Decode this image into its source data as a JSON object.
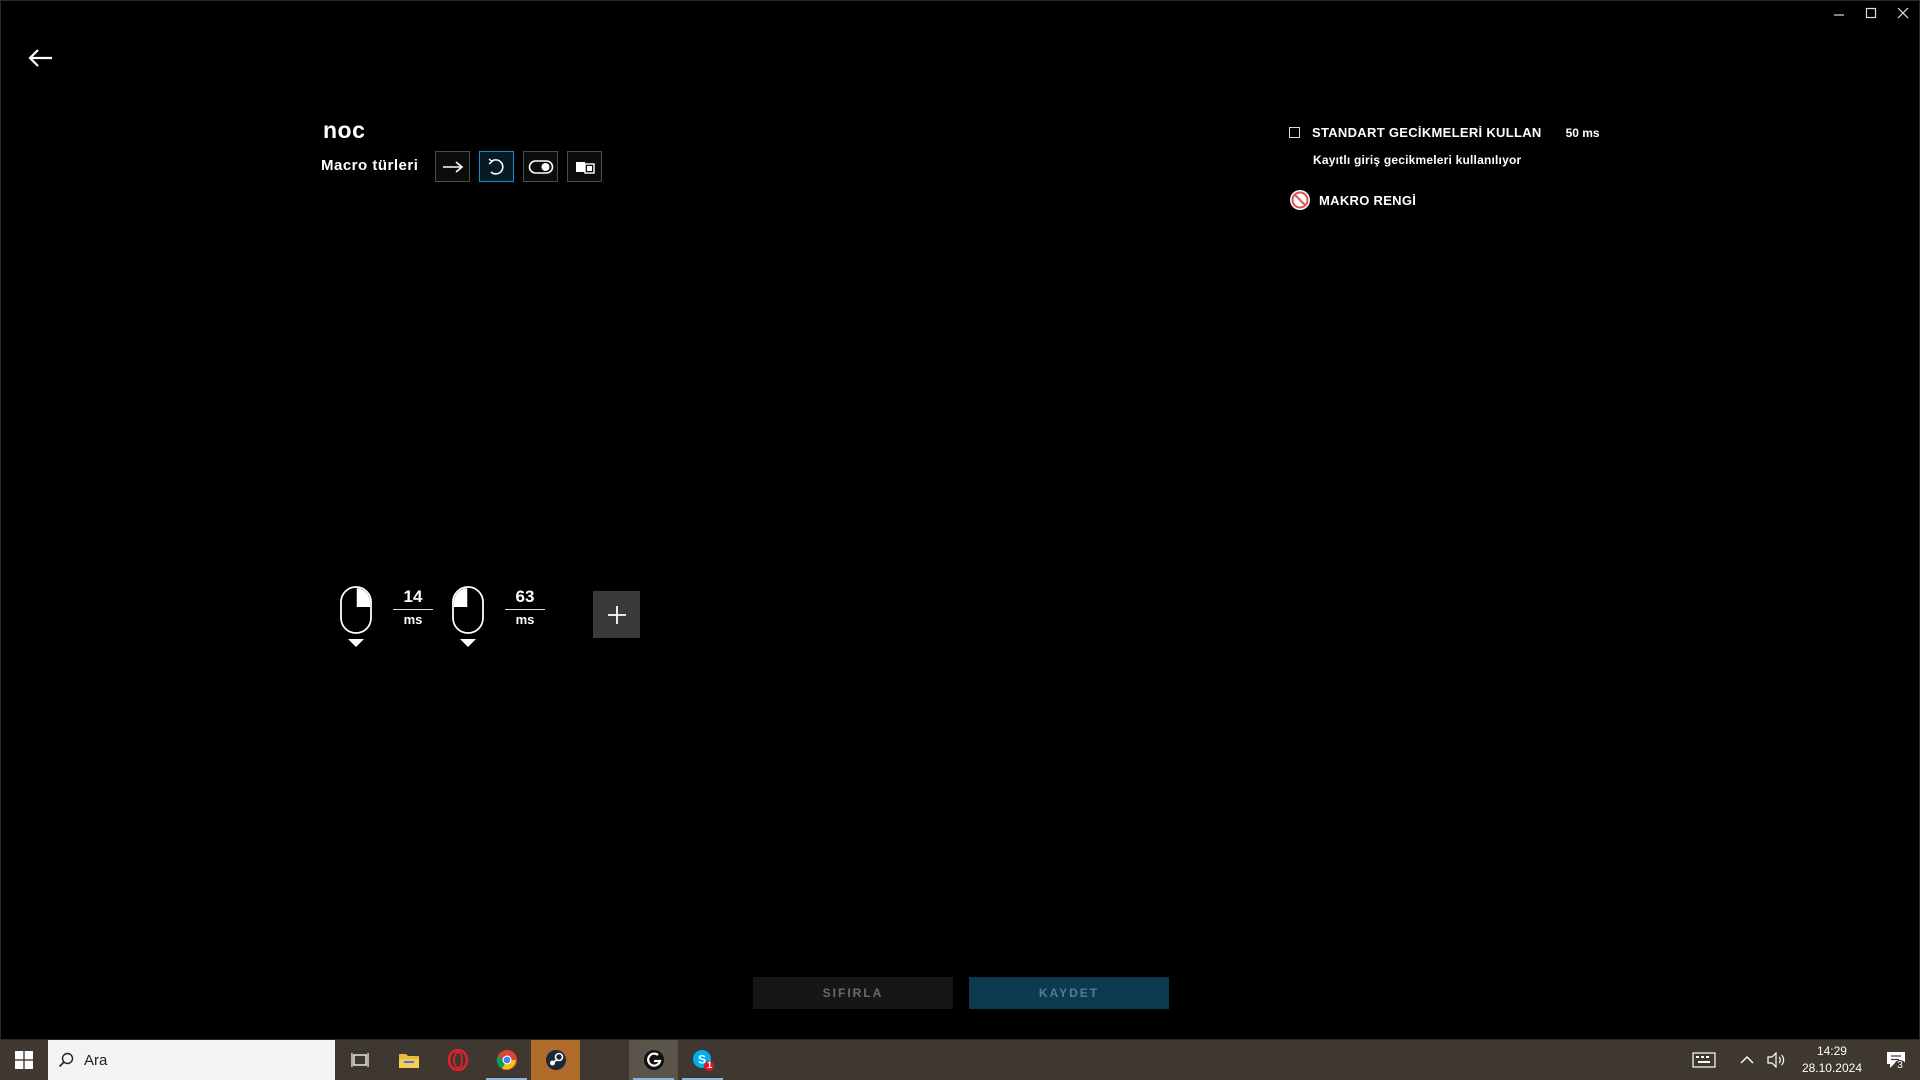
{
  "window": {
    "controls": [
      {
        "name": "minimize-button",
        "glyph": "minimize-icon"
      },
      {
        "name": "maximize-button",
        "glyph": "maximize-icon"
      },
      {
        "name": "close-button",
        "glyph": "close-icon"
      }
    ]
  },
  "macro": {
    "name": "noc",
    "types_label": "Macro türleri",
    "types": [
      "arrow-right-icon",
      "repeat-icon",
      "toggle-icon",
      "sequence-icon"
    ],
    "active_type_index": 1
  },
  "settings": {
    "standard_delays_label": "STANDART GECİKMELERİ KULLAN",
    "standard_delays_value": "50 ms",
    "standard_delays_checked": false,
    "recorded_delays_note": "Kayıtlı giriş gecikmeleri kullanılıyor",
    "macro_color_label": "MAKRO RENGİ",
    "macro_color": "none"
  },
  "sequence": {
    "steps": [
      {
        "type": "mouse-right-click",
        "delay": "14",
        "unit": "ms"
      },
      {
        "type": "mouse-left-click",
        "delay": "63",
        "unit": "ms"
      }
    ]
  },
  "buttons": {
    "reset": "SIFIRLA",
    "save": "KAYDET"
  },
  "taskbar": {
    "search_placeholder": "Ara",
    "apps": [
      "task-view-icon",
      "file-explorer-icon",
      "opera-icon",
      "chrome-icon",
      "steam-icon",
      "logitech-ghub-icon",
      "skype-icon"
    ],
    "skype_badge": "1",
    "notifications_count": "3",
    "time": "14:29",
    "date": "28.10.2024"
  },
  "colors": {
    "accent": "#1b8fc7",
    "save_bg": "#0d3a4f",
    "taskbar_bg": "#3f3830"
  }
}
